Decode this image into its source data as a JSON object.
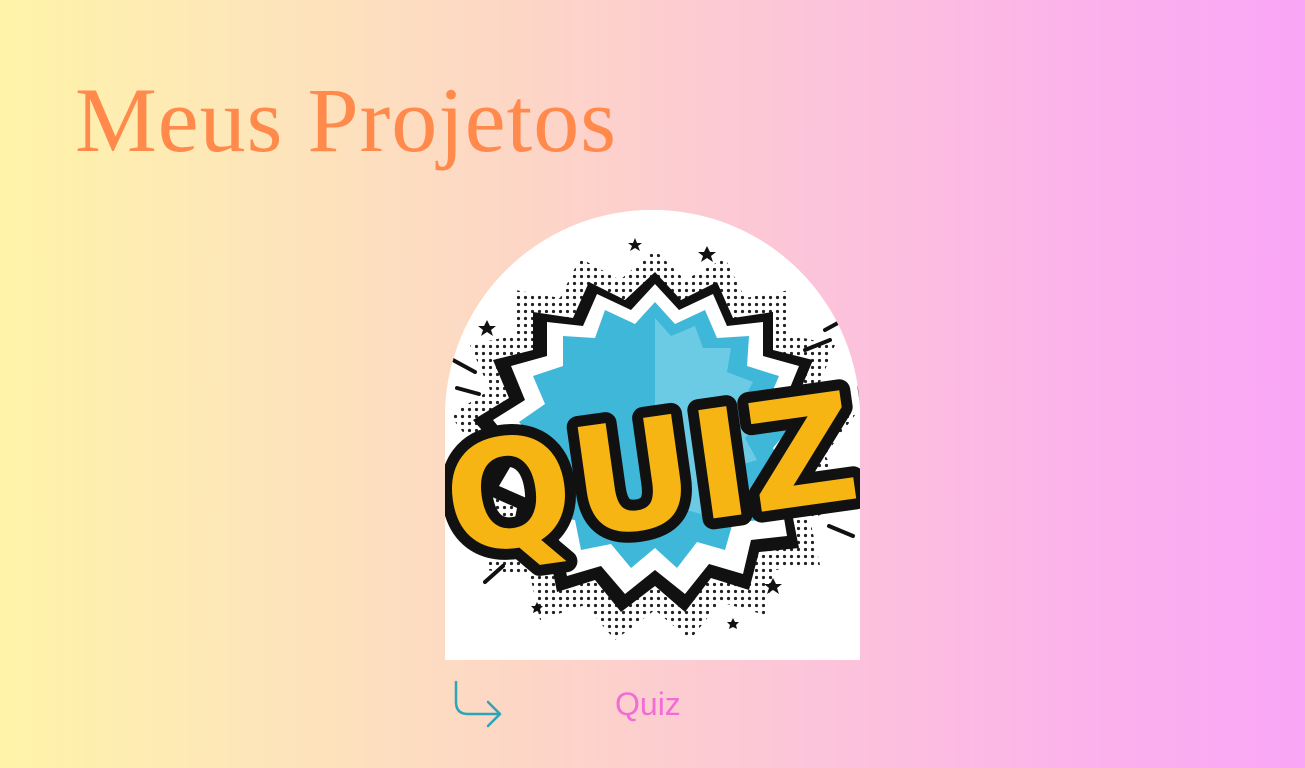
{
  "header": {
    "title": "Meus Projetos"
  },
  "projects": [
    {
      "label": "Quiz",
      "image_text": "QUIZ!",
      "link_icon": "arrow-turn-down-right-icon"
    }
  ],
  "colors": {
    "title": "#ff8a4c",
    "label": "#f26bd6",
    "arrow": "#2ba5b8",
    "quiz_letters": "#f7b513",
    "burst_blue": "#3fb7d9",
    "outline": "#111111"
  }
}
